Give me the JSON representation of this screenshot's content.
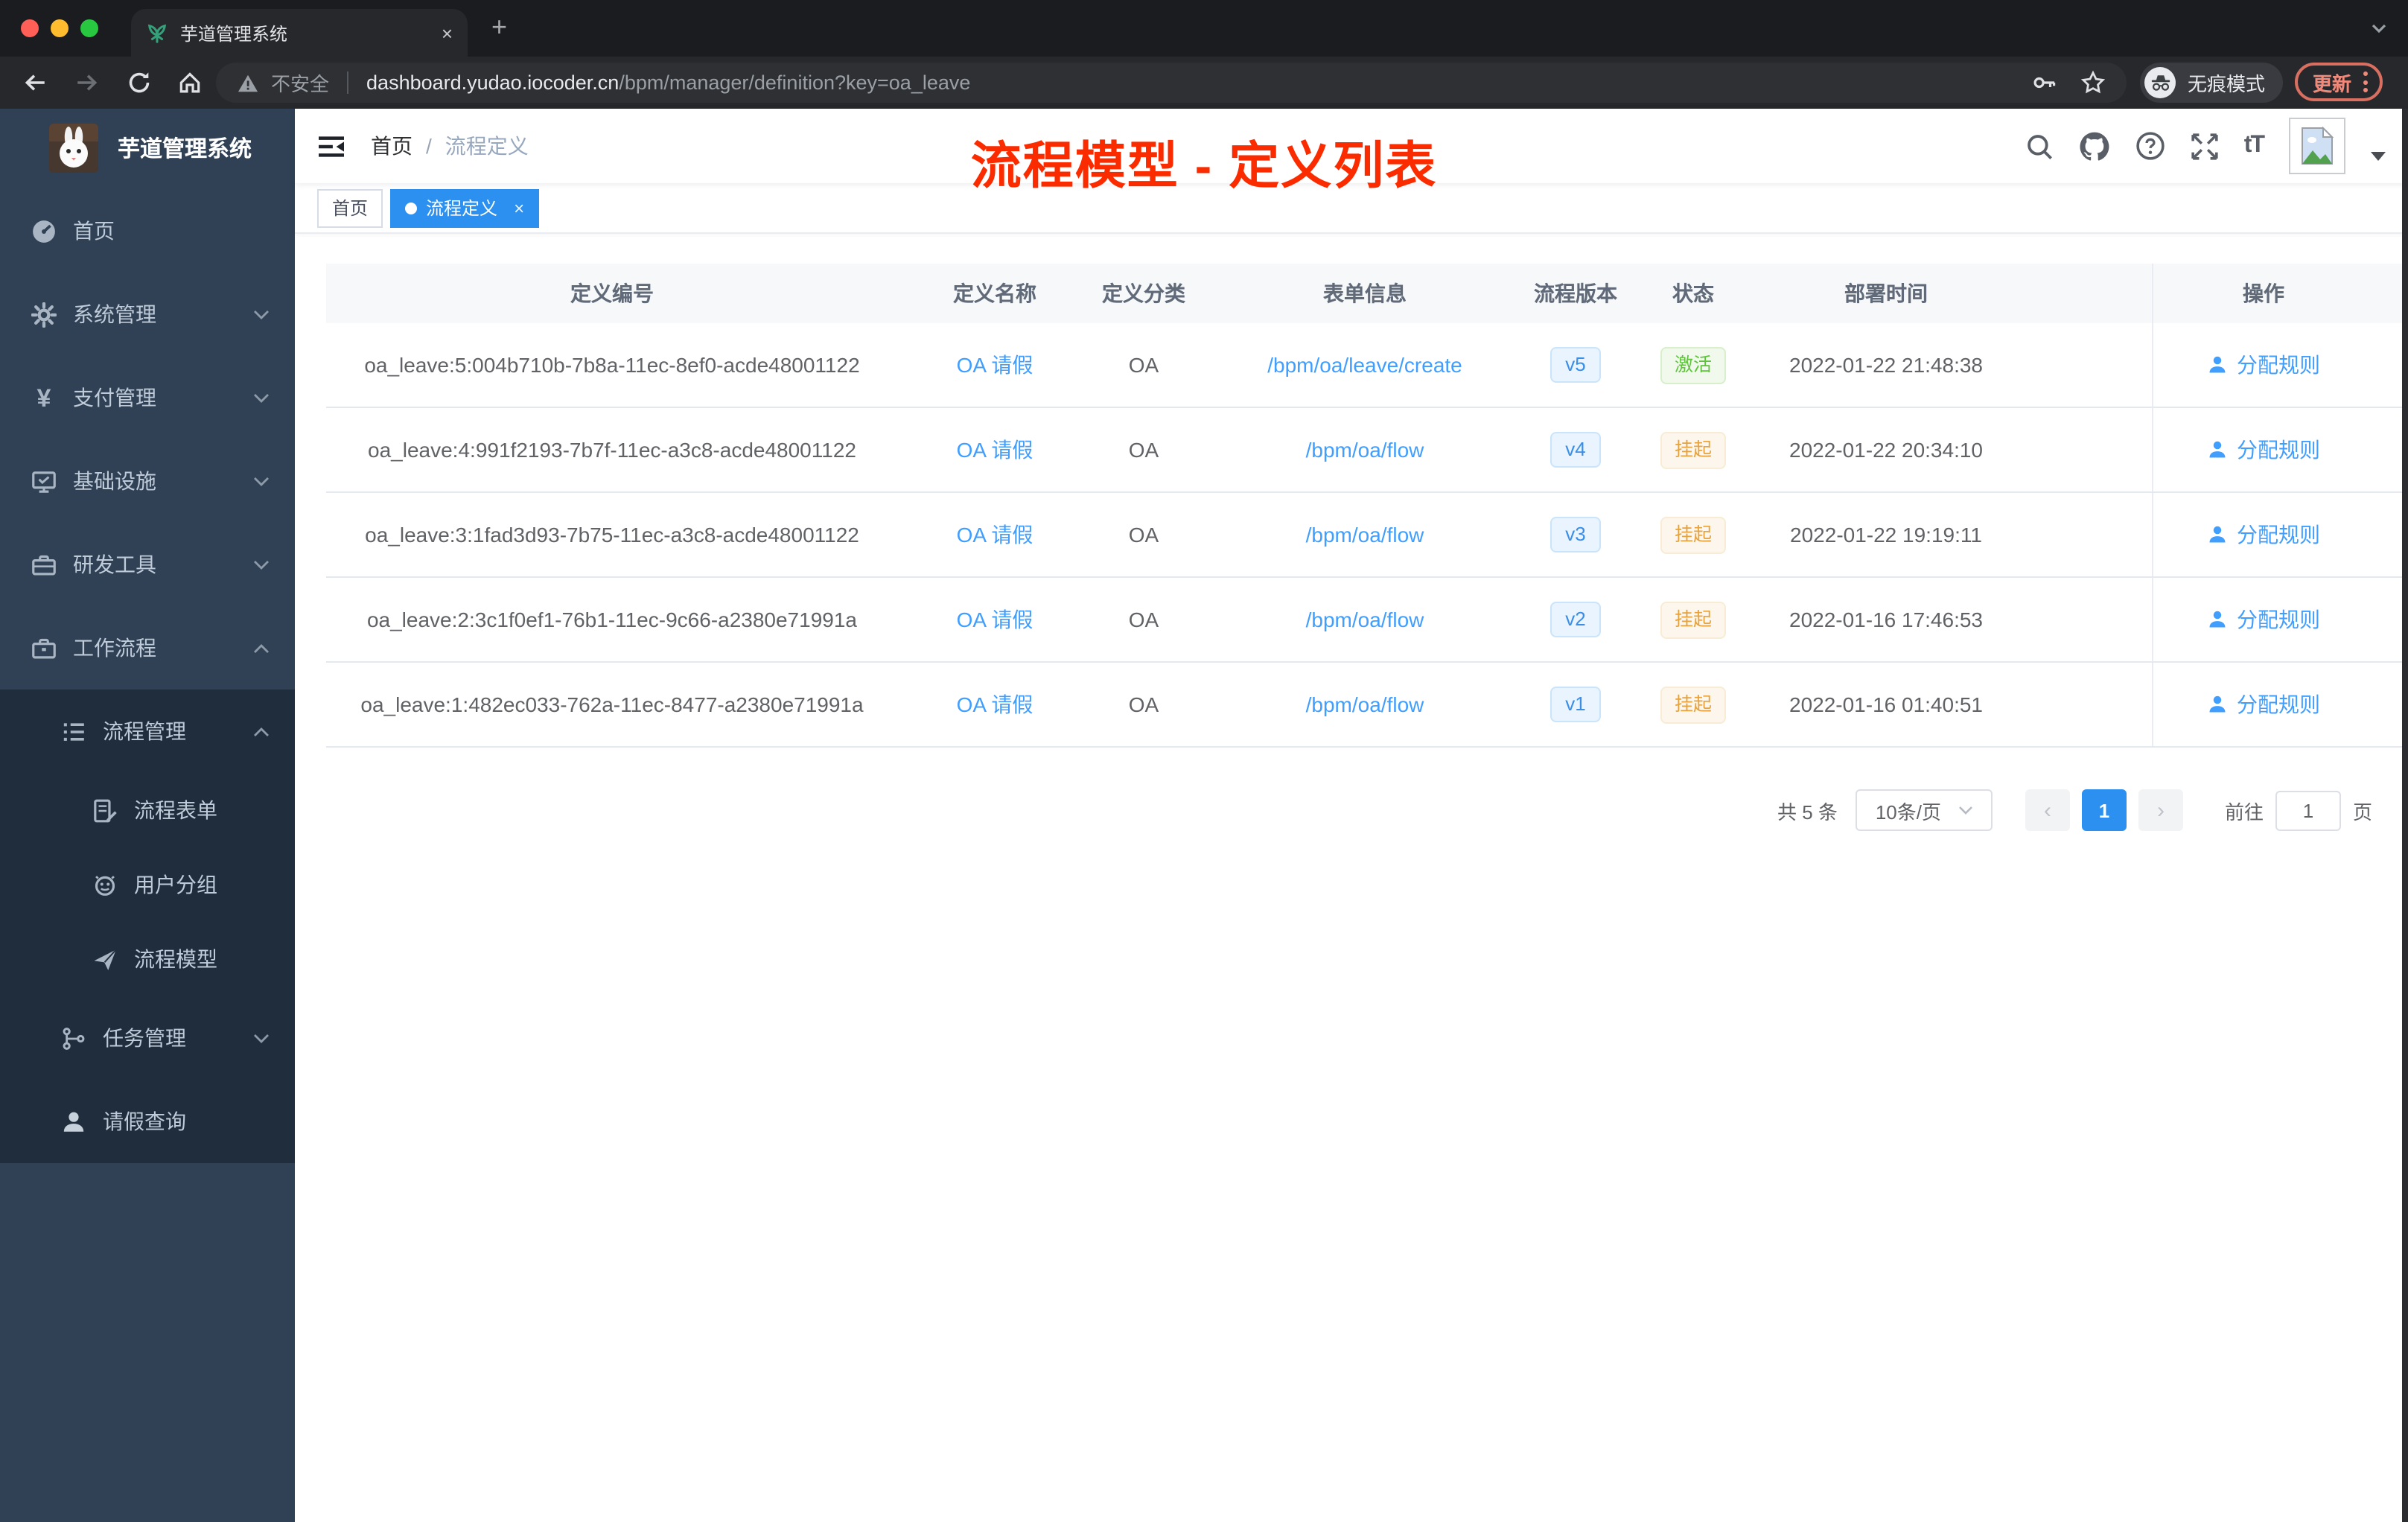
{
  "browser": {
    "tab_title": "芋道管理系统",
    "close_tab_glyph": "×",
    "new_tab_glyph": "+",
    "security_label": "不安全",
    "url_host": "dashboard.yudao.iocoder.cn",
    "url_path": "/bpm/manager/definition?key=oa_leave",
    "incognito_label": "无痕模式",
    "update_label": "更新"
  },
  "sidebar": {
    "app_title": "芋道管理系统",
    "menu": [
      {
        "label": "首页"
      },
      {
        "label": "系统管理"
      },
      {
        "label": "支付管理"
      },
      {
        "label": "基础设施"
      },
      {
        "label": "研发工具"
      },
      {
        "label": "工作流程"
      },
      {
        "label": "流程管理"
      },
      {
        "label": "流程表单"
      },
      {
        "label": "用户分组"
      },
      {
        "label": "流程模型"
      },
      {
        "label": "任务管理"
      },
      {
        "label": "请假查询"
      }
    ]
  },
  "navbar": {
    "breadcrumb_home": "首页",
    "breadcrumb_sep": "/",
    "breadcrumb_current": "流程定义",
    "annotation": "流程模型 - 定义列表"
  },
  "tags": {
    "home": "首页",
    "active": "流程定义",
    "close_glyph": "×"
  },
  "table": {
    "headers": [
      "定义编号",
      "定义名称",
      "定义分类",
      "表单信息",
      "流程版本",
      "状态",
      "部署时间",
      "操作"
    ],
    "action_label": "分配规则",
    "rows": [
      {
        "id": "oa_leave:5:004b710b-7b8a-11ec-8ef0-acde48001122",
        "name": "OA 请假",
        "category": "OA",
        "form": "/bpm/oa/leave/create",
        "version": "v5",
        "status": "激活",
        "status_type": "success",
        "time": "2022-01-22 21:48:38"
      },
      {
        "id": "oa_leave:4:991f2193-7b7f-11ec-a3c8-acde48001122",
        "name": "OA 请假",
        "category": "OA",
        "form": "/bpm/oa/flow",
        "version": "v4",
        "status": "挂起",
        "status_type": "warning",
        "time": "2022-01-22 20:34:10"
      },
      {
        "id": "oa_leave:3:1fad3d93-7b75-11ec-a3c8-acde48001122",
        "name": "OA 请假",
        "category": "OA",
        "form": "/bpm/oa/flow",
        "version": "v3",
        "status": "挂起",
        "status_type": "warning",
        "time": "2022-01-22 19:19:11"
      },
      {
        "id": "oa_leave:2:3c1f0ef1-76b1-11ec-9c66-a2380e71991a",
        "name": "OA 请假",
        "category": "OA",
        "form": "/bpm/oa/flow",
        "version": "v2",
        "status": "挂起",
        "status_type": "warning",
        "time": "2022-01-16 17:46:53"
      },
      {
        "id": "oa_leave:1:482ec033-762a-11ec-8477-a2380e71991a",
        "name": "OA 请假",
        "category": "OA",
        "form": "/bpm/oa/flow",
        "version": "v1",
        "status": "挂起",
        "status_type": "warning",
        "time": "2022-01-16 01:40:51"
      }
    ]
  },
  "pagination": {
    "total": "共 5 条",
    "page_size": "10条/页",
    "prev_glyph": "‹",
    "current_page": "1",
    "next_glyph": "›",
    "goto_label": "前往",
    "goto_value": "1",
    "unit_label": "页"
  },
  "colors": {
    "accent": "#409eff",
    "tag_active": "#2b90f0",
    "annotation": "#fb2b00",
    "success": "#67c23a",
    "warning": "#e6a23c",
    "sidebar_bg": "#304156",
    "submenu_bg": "#1f2d3d"
  }
}
